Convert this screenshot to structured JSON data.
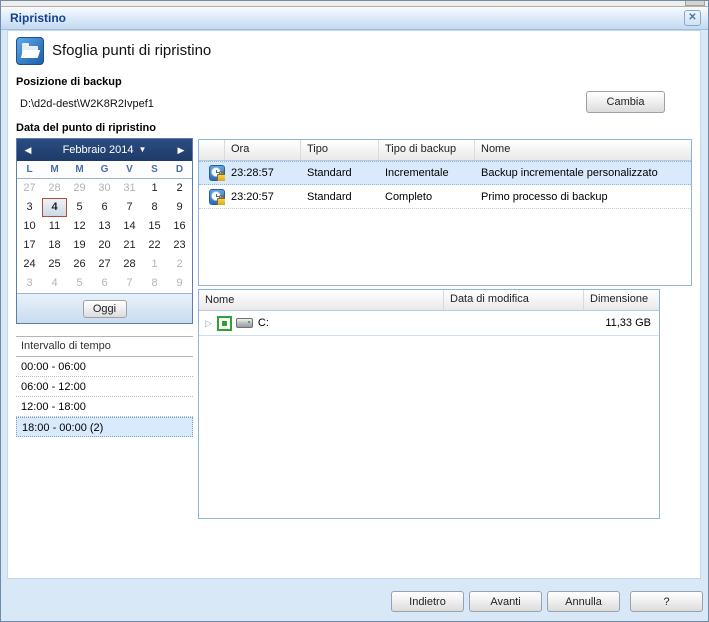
{
  "window": {
    "title": "Ripristino"
  },
  "icons": {
    "close": "✕",
    "prev": "◀",
    "next": "▶",
    "dropdown": "▼",
    "expand": "▷"
  },
  "page": {
    "heading": "Sfoglia punti di ripristino"
  },
  "backup_location": {
    "label": "Posizione di backup",
    "path": "D:\\d2d-dest\\W2K8R2Ivpef1",
    "change_button": "Cambia"
  },
  "restore_date_label": "Data del punto di ripristino",
  "calendar": {
    "month_label": "Febbraio 2014",
    "day_headers": [
      "L",
      "M",
      "M",
      "G",
      "V",
      "S",
      "D"
    ],
    "weeks": [
      [
        {
          "d": "27",
          "muted": true
        },
        {
          "d": "28",
          "muted": true
        },
        {
          "d": "29",
          "muted": true
        },
        {
          "d": "30",
          "muted": true
        },
        {
          "d": "31",
          "muted": true
        },
        {
          "d": "1"
        },
        {
          "d": "2"
        }
      ],
      [
        {
          "d": "3"
        },
        {
          "d": "4",
          "selected": true
        },
        {
          "d": "5"
        },
        {
          "d": "6"
        },
        {
          "d": "7"
        },
        {
          "d": "8"
        },
        {
          "d": "9"
        }
      ],
      [
        {
          "d": "10"
        },
        {
          "d": "11"
        },
        {
          "d": "12"
        },
        {
          "d": "13"
        },
        {
          "d": "14"
        },
        {
          "d": "15"
        },
        {
          "d": "16"
        }
      ],
      [
        {
          "d": "17"
        },
        {
          "d": "18"
        },
        {
          "d": "19"
        },
        {
          "d": "20"
        },
        {
          "d": "21"
        },
        {
          "d": "22"
        },
        {
          "d": "23"
        }
      ],
      [
        {
          "d": "24"
        },
        {
          "d": "25"
        },
        {
          "d": "26"
        },
        {
          "d": "27"
        },
        {
          "d": "28"
        },
        {
          "d": "1",
          "muted": true
        },
        {
          "d": "2",
          "muted": true
        }
      ],
      [
        {
          "d": "3",
          "muted": true
        },
        {
          "d": "4",
          "muted": true
        },
        {
          "d": "5",
          "muted": true
        },
        {
          "d": "6",
          "muted": true
        },
        {
          "d": "7",
          "muted": true
        },
        {
          "d": "8",
          "muted": true
        },
        {
          "d": "9",
          "muted": true
        }
      ]
    ],
    "today_button": "Oggi"
  },
  "time_range": {
    "header": "Intervallo di tempo",
    "items": [
      {
        "label": "00:00 - 06:00"
      },
      {
        "label": "06:00 - 12:00"
      },
      {
        "label": "12:00 - 18:00"
      },
      {
        "label": "18:00 - 00:00 (2)",
        "selected": true
      }
    ]
  },
  "restore_points": {
    "columns": [
      "Ora",
      "Tipo",
      "Tipo di backup",
      "Nome"
    ],
    "rows": [
      {
        "ora": "23:28:57",
        "tipo": "Standard",
        "tipo_di_backup": "Incrementale",
        "nome": "Backup incrementale personalizzato",
        "selected": true
      },
      {
        "ora": "23:20:57",
        "tipo": "Standard",
        "tipo_di_backup": "Completo",
        "nome": "Primo processo di backup"
      }
    ]
  },
  "volumes": {
    "columns": [
      "Nome",
      "Data di modifica",
      "Dimensione"
    ],
    "rows": [
      {
        "nome": "C:",
        "data_di_modifica": "",
        "dimensione": "11,33 GB"
      }
    ]
  },
  "footer": {
    "buttons": [
      "Indietro",
      "Avanti",
      "Annulla",
      "?"
    ]
  },
  "colors": {
    "titlebar_text": "#15428b",
    "calendar_header": "#1f3d6d",
    "selection_fill": "#d9eafc",
    "selected_day_border": "#ab4f3c",
    "table_border": "#8fb4dc",
    "checkbox_green": "#2fa32f"
  }
}
